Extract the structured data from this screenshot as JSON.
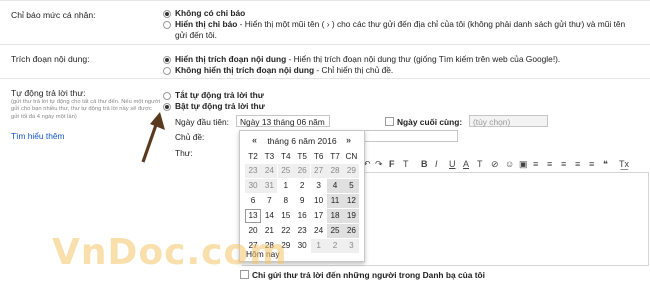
{
  "sections": {
    "personal_level": {
      "label": "Chỉ báo mức cá nhân:",
      "options": [
        {
          "bold": "Không có chỉ báo",
          "rest": ""
        },
        {
          "bold": "Hiển thị chỉ báo",
          "rest": " - Hiển thị một mũi tên ( › ) cho các thư gửi đến địa chỉ của tôi (không phải danh sách gửi thư) và mũi tên",
          "rest2": "gửi đến tôi."
        }
      ]
    },
    "snippets": {
      "label": "Trích đoạn nội dung:",
      "options": [
        {
          "bold": "Hiển thị trích đoạn nội dung",
          "rest": " - Hiển thị trích đoạn nội dung thư (giống Tìm kiếm trên web của Google!)."
        },
        {
          "bold": "Không hiển thị trích đoạn nội dung",
          "rest": " - Chỉ hiển thị chủ đề."
        }
      ]
    },
    "vacation": {
      "label": "Tự động trả lời thư:",
      "description": "(gửi thư trả lời tự động cho tất cả thư đến. Nếu một người gửi cho bạn nhiều thư, thư tự động trả lời này sẽ được gửi tối đa 4 ngày một lần)",
      "learn_more": "Tìm hiểu thêm",
      "options": [
        {
          "bold": "Tắt tự động trả lời thư"
        },
        {
          "bold": "Bật tự động trả lời thư"
        }
      ],
      "first_day_label": "Ngày đầu tiên:",
      "first_day_value": "Ngày 13 tháng 06 năm",
      "last_day_label": "Ngày cuối cùng:",
      "last_day_placeholder": "(tùy chọn)",
      "subject_label": "Chủ đề:",
      "message_label": "Thư:",
      "contacts_only": "Chỉ gửi thư trả lời đến những người trong Danh bạ của tôi"
    }
  },
  "calendar": {
    "title": "tháng 6 năm 2016",
    "prev": "«",
    "next": "»",
    "weekdays": [
      "T2",
      "T3",
      "T4",
      "T5",
      "T6",
      "T7",
      "CN"
    ],
    "weeks": [
      [
        "23",
        "24",
        "25",
        "26",
        "27",
        "28",
        "29"
      ],
      [
        "30",
        "31",
        "1",
        "2",
        "3",
        "4",
        "5"
      ],
      [
        "6",
        "7",
        "8",
        "9",
        "10",
        "11",
        "12"
      ],
      [
        "13",
        "14",
        "15",
        "16",
        "17",
        "18",
        "19"
      ],
      [
        "20",
        "21",
        "22",
        "23",
        "24",
        "25",
        "26"
      ],
      [
        "27",
        "28",
        "29",
        "30",
        "1",
        "2",
        "3"
      ]
    ],
    "today_label": "Hôm nay"
  },
  "toolbar": [
    "↶",
    "↷",
    "F",
    "T",
    "B",
    "I",
    "U",
    "A",
    "T",
    "⊘",
    "☺",
    "▣",
    "≡",
    "≡",
    "≡",
    "≡",
    "≡",
    "❝",
    "T͟x"
  ],
  "watermark": "VnDoc.com"
}
